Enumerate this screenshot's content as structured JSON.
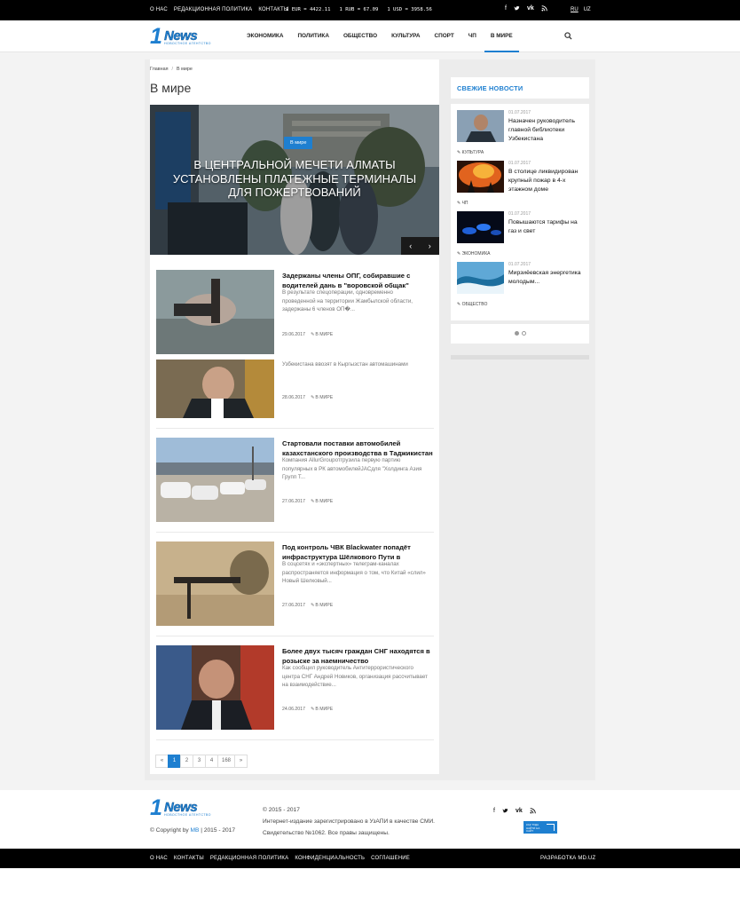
{
  "topbar": {
    "links": [
      "О НАС",
      "РЕДАКЦИОННАЯ ПОЛИТИКА",
      "КОНТАКТЫ"
    ],
    "rates": [
      "1 EUR = 4422.11",
      "1 RUB = 67.09",
      "1 USD = 3958.56"
    ],
    "social_icons": [
      "facebook-icon",
      "twitter-icon",
      "vk-icon",
      "rss-icon"
    ],
    "languages": [
      "RU",
      "UZ"
    ]
  },
  "header": {
    "logo": {
      "one": "1",
      "news": "News",
      "sub": "новостное агентство"
    },
    "nav": [
      "ЭКОНОМИКА",
      "ПОЛИТИКА",
      "ОБЩЕСТВО",
      "КУЛЬТУРА",
      "СПОРТ",
      "ЧП",
      "В МИРЕ"
    ],
    "active_nav": "В МИРЕ",
    "search_icon": "search-icon"
  },
  "breadcrumb": {
    "home": "Главная",
    "sep": "/",
    "current": "В мире"
  },
  "page_title": "В мире",
  "hero": {
    "category": "В мире",
    "title": "В центральной мечети Алматы установлены платежные терминалы для пожертвований",
    "prev": "‹",
    "next": "›"
  },
  "articles": [
    {
      "title": "Задержаны члены ОПГ, собиравшие с водителей дань в \"воровской общак\"",
      "desc": "В результате спецоперации, одновременно проведенной на территории Жамбылской области, задержаны 6 членов ОП�...",
      "date": "29.06.2017",
      "tag": "В МИРЕ"
    },
    {
      "title": "",
      "desc": "Узбекистана ввозят в Кыргызстан автомашинами",
      "date": "28.06.2017",
      "tag": "В МИРЕ"
    },
    {
      "title": "Стартовали поставки автомобилей казахстанского производства в Таджикистан",
      "desc": "Компания AllurGroupотгрузила первую партию популярных в РК  автомобилейJACдля \"Холдинга Азия Групп Т...",
      "date": "27.06.2017",
      "tag": "В МИРЕ"
    },
    {
      "title": "Под контроль ЧВК Blackwater попадёт инфраструктура Шёлкового Пути в",
      "desc": "В соцсетях и «экспертных» телеграм-каналах распространяется информация о том, что Китай «слил» Новый Шелковый...",
      "date": "27.06.2017",
      "tag": "В МИРЕ"
    },
    {
      "title": "Более двух тысяч граждан СНГ находятся в розыске за наемничество",
      "desc": "Как сообщил руководитель Антитеррористического центра СНГ Андрей Новиков, организация рассчитывает на взаимодействие...",
      "date": "24.06.2017",
      "tag": "В МИРЕ"
    }
  ],
  "pagination": [
    "«",
    "1",
    "2",
    "3",
    "4",
    "168",
    "»"
  ],
  "sidebar": {
    "heading": "Свежие новости",
    "items": [
      {
        "date": "01.07.2017",
        "title": "Назначен руководитель главной библиотеки Узбекистана",
        "tag": "КУЛЬТУРА"
      },
      {
        "date": "01.07.2017",
        "title": "В столице ликвидирован крупный пожар в 4-х этажном доме",
        "tag": "ЧП"
      },
      {
        "date": "01.07.2017",
        "title": "Повышаются тарифы на газ и свет",
        "tag": "ЭКОНОМИКА"
      },
      {
        "date": "01.07.2017",
        "title": "Мирзиёевская энергетика молодым...",
        "tag": "ОБЩЕСТВО"
      }
    ]
  },
  "footer": {
    "copyright_prefix": "© Copyright by ",
    "copyright_link": "MB",
    "copyright_suffix": " | 2015 - 2017",
    "years": "© 2015 - 2017",
    "line1": "Интернет-издание зарегистрировано в УзАПИ в качестве СМИ.",
    "line2": "Свидетельство №1062. Все правы защищены.",
    "badge": "КАК ТУДА НАЙТИ НА САЙТ"
  },
  "bottombar": {
    "links": [
      "О НАС",
      "КОНТАКТЫ",
      "РЕДАКЦИОННАЯ ПОЛИТИКА",
      "КОНФИДЕНЦИАЛЬНОСТЬ",
      "СОГЛАШЕНИЕ"
    ],
    "developer": "РАЗРАБОТКА MD.UZ"
  },
  "colors": {
    "accent": "#1e7fd0",
    "topbar": "#000000"
  }
}
